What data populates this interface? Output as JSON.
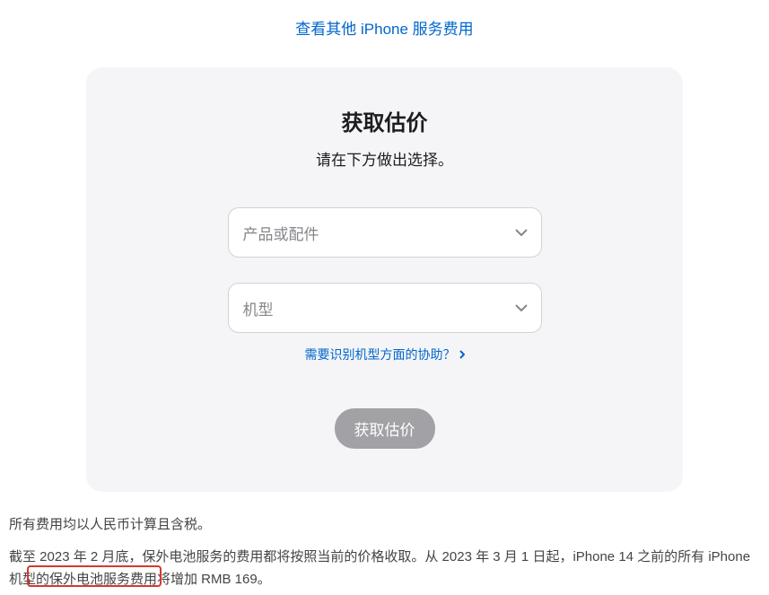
{
  "topLink": {
    "label": "查看其他 iPhone 服务费用"
  },
  "card": {
    "title": "获取估价",
    "subtitle": "请在下方做出选择。",
    "productSelect": {
      "placeholder": "产品或配件"
    },
    "modelSelect": {
      "placeholder": "机型"
    },
    "helpLink": "需要识别机型方面的协助？",
    "submitLabel": "获取估价"
  },
  "footer": {
    "line1": "所有费用均以人民币计算且含税。",
    "line2": "截至 2023 年 2 月底，保外电池服务的费用都将按照当前的价格收取。从 2023 年 3 月 1 日起，iPhone 14 之前的所有 iPhone 机型的保外电池服务费用将增加 RMB 169。"
  }
}
